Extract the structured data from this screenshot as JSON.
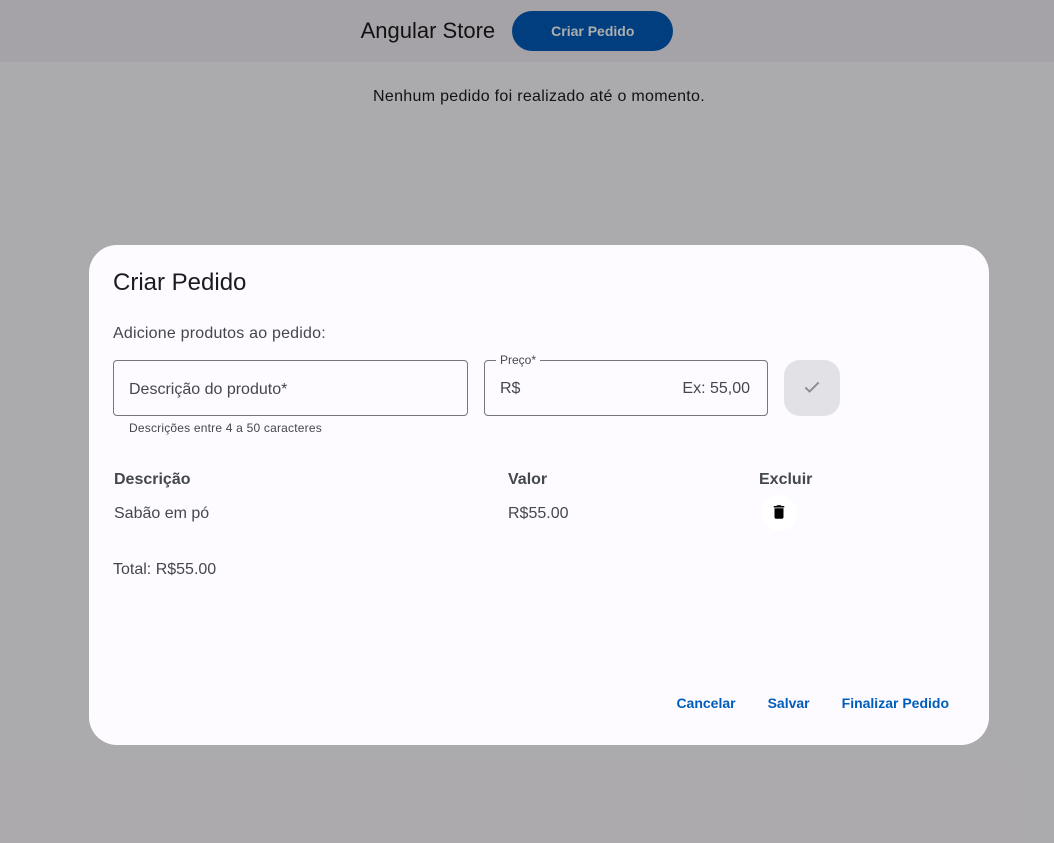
{
  "toolbar": {
    "app_title": "Angular Store",
    "create_order_label": "Criar Pedido"
  },
  "main": {
    "empty_message": "Nenhum pedido foi realizado até o momento."
  },
  "dialog": {
    "title": "Criar Pedido",
    "subtitle": "Adicione produtos ao pedido:",
    "description_field": {
      "label": "Descrição do produto*",
      "hint": "Descrições entre 4 a 50 caracteres"
    },
    "price_field": {
      "label": "Preço*",
      "prefix": "R$",
      "placeholder": "Ex: 55,00"
    },
    "add_icon": "check-icon",
    "table": {
      "headers": [
        "Descrição",
        "Valor",
        "Excluir"
      ],
      "rows": [
        {
          "description": "Sabão em pó",
          "value": "R$55.00",
          "delete_icon": "trash-icon"
        }
      ]
    },
    "total": "Total: R$55.00",
    "actions": {
      "cancel": "Cancelar",
      "save": "Salvar",
      "finalize": "Finalizar Pedido"
    }
  },
  "colors": {
    "primary": "#005cbb",
    "scrim": "rgba(0,0,0,0.32)",
    "surface": "#fdfbff"
  }
}
